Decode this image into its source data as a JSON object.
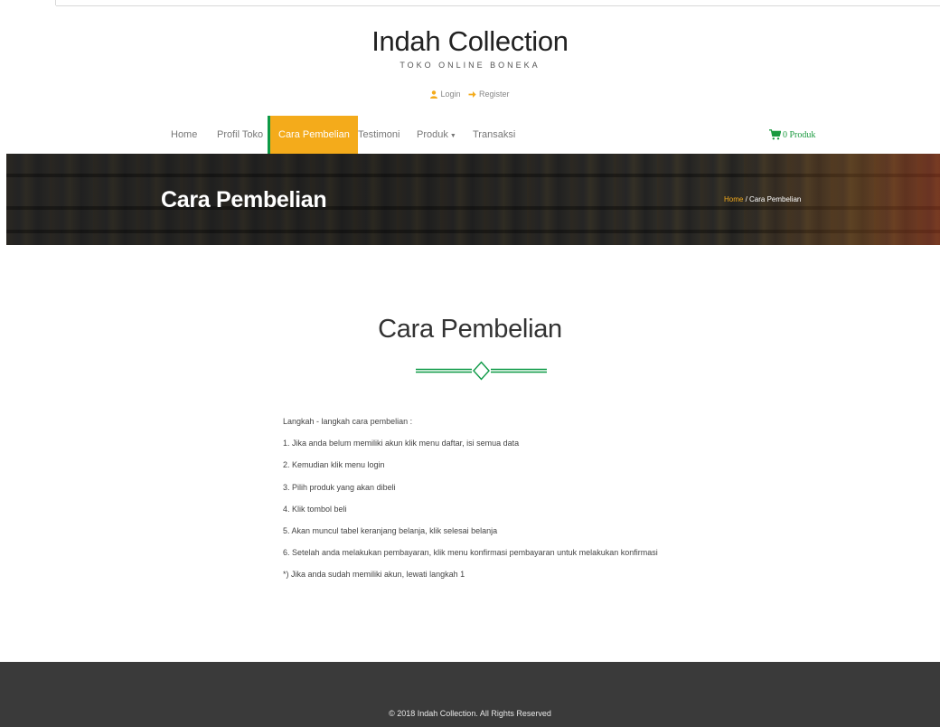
{
  "brand": {
    "title": "Indah Collection",
    "tagline": "TOKO ONLINE BONEKA"
  },
  "auth": {
    "login_label": "Login",
    "login_icon": "user-icon",
    "register_label": "Register",
    "register_icon": "arrow-right-icon"
  },
  "nav": {
    "items": [
      {
        "label": "Home"
      },
      {
        "label": "Profil Toko"
      },
      {
        "label": "Cara Pembelian"
      },
      {
        "label": "Testimoni"
      },
      {
        "label": "Produk"
      },
      {
        "label": "Transaksi"
      }
    ],
    "active": "Cara Pembelian",
    "cart_label": "0 Produk",
    "cart_icon": "cart-icon"
  },
  "banner": {
    "heading": "Cara Pembelian",
    "breadcrumb_home": "Home",
    "breadcrumb_sep": " / ",
    "breadcrumb_current": "Cara Pembelian"
  },
  "section": {
    "title": "Cara Pembelian",
    "steps": [
      "Langkah - langkah cara pembelian :",
      "1. Jika anda belum memiliki akun klik menu daftar, isi semua data",
      "2. Kemudian klik menu login",
      "3. Pilih produk yang akan dibeli",
      "4. Klik tombol beli",
      "5. Akan muncul tabel keranjang belanja, klik selesai belanja",
      "6. Setelah anda melakukan pembayaran, klik menu konfirmasi pembayaran untuk melakukan konfirmasi",
      "*) Jika anda sudah memiliki akun, lewati langkah 1"
    ]
  },
  "footer": {
    "copyright": "© 2018 Indah Collection. All Rights Reserved"
  },
  "colors": {
    "accent": "#f4ab1b",
    "green": "#0e9a47",
    "footer_bg": "#3a3a3a"
  }
}
